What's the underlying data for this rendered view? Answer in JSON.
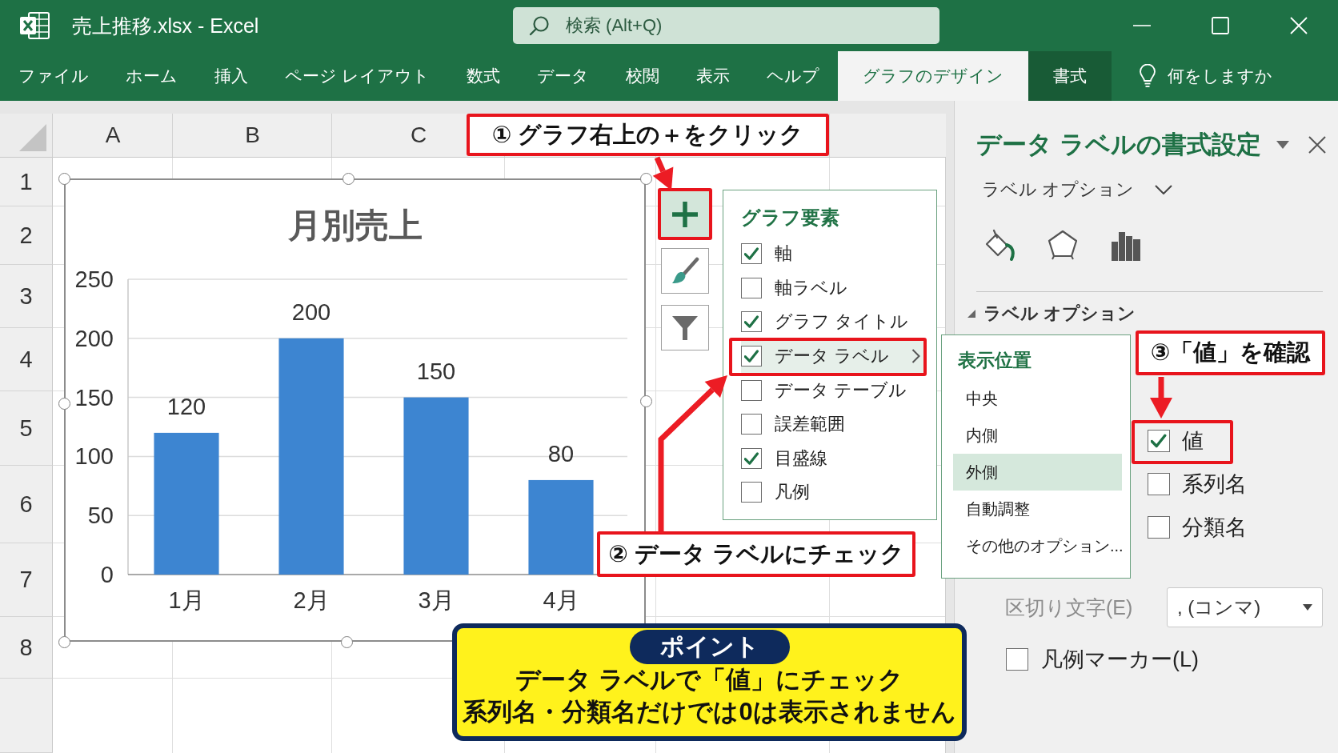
{
  "window": {
    "title": "売上推移.xlsx - Excel",
    "search": {
      "placeholder": "検索 (Alt+Q)"
    }
  },
  "ribbon": {
    "tabs": [
      {
        "label": "ファイル",
        "kind": "standard",
        "selected": false
      },
      {
        "label": "ホーム",
        "kind": "standard",
        "selected": false
      },
      {
        "label": "挿入",
        "kind": "standard",
        "selected": false
      },
      {
        "label": "ページ レイアウト",
        "kind": "standard",
        "selected": false
      },
      {
        "label": "数式",
        "kind": "standard",
        "selected": false
      },
      {
        "label": "データ",
        "kind": "standard",
        "selected": false
      },
      {
        "label": "校閲",
        "kind": "standard",
        "selected": false
      },
      {
        "label": "表示",
        "kind": "standard",
        "selected": false
      },
      {
        "label": "ヘルプ",
        "kind": "standard",
        "selected": false
      },
      {
        "label": "グラフのデザイン",
        "kind": "contextual",
        "selected": true
      },
      {
        "label": "書式",
        "kind": "contextual",
        "selected": false
      }
    ],
    "tell_me": "何をしますか"
  },
  "sheet": {
    "columns": [
      "A",
      "B",
      "C"
    ],
    "rows": [
      "1",
      "2",
      "3",
      "4",
      "5",
      "6",
      "7",
      "8"
    ]
  },
  "chart": {
    "chart_data": {
      "type": "bar",
      "title": "月別売上",
      "categories": [
        "1月",
        "2月",
        "3月",
        "4月"
      ],
      "values": [
        120,
        200,
        150,
        80
      ],
      "ylim": [
        0,
        250
      ],
      "yticks": [
        0,
        50,
        100,
        150,
        200,
        250
      ],
      "grid": true,
      "data_labels": true
    }
  },
  "chart_buttons": [
    {
      "kind": "add",
      "selected": true
    },
    {
      "kind": "style",
      "selected": false
    },
    {
      "kind": "filter",
      "selected": false
    }
  ],
  "chart_elements": {
    "title": "グラフ要素",
    "items": [
      {
        "label": "軸",
        "checked": true,
        "selected": false,
        "submenu": false
      },
      {
        "label": "軸ラベル",
        "checked": false,
        "selected": false,
        "submenu": false
      },
      {
        "label": "グラフ タイトル",
        "checked": true,
        "selected": false,
        "submenu": false
      },
      {
        "label": "データ ラベル",
        "checked": true,
        "selected": true,
        "submenu": true
      },
      {
        "label": "データ テーブル",
        "checked": false,
        "selected": false,
        "submenu": false
      },
      {
        "label": "誤差範囲",
        "checked": false,
        "selected": false,
        "submenu": false
      },
      {
        "label": "目盛線",
        "checked": true,
        "selected": false,
        "submenu": false
      },
      {
        "label": "凡例",
        "checked": false,
        "selected": false,
        "submenu": false
      }
    ]
  },
  "label_position_menu": {
    "title": "表示位置",
    "items": [
      {
        "label": "中央",
        "selected": false
      },
      {
        "label": "内側",
        "selected": false
      },
      {
        "label": "外側",
        "selected": true
      },
      {
        "label": "自動調整",
        "selected": false
      },
      {
        "label": "その他のオプション...",
        "selected": false
      }
    ]
  },
  "format_pane": {
    "title": "データ ラベルの書式設定",
    "options_menu": "ラベル オプション",
    "section": {
      "title": "ラベル オプション",
      "expanded": true
    },
    "label_contains": [
      {
        "label": "値",
        "checked": true
      },
      {
        "label": "系列名",
        "checked": false
      },
      {
        "label": "分類名",
        "checked": false
      }
    ],
    "separator": {
      "label": "区切り文字(E)",
      "value": ", (コンマ)",
      "disabled": true
    },
    "legend_key": {
      "label": "凡例マーカー(L)",
      "checked": false
    }
  },
  "callouts": [
    {
      "text": "① グラフ右上の＋をクリック"
    },
    {
      "text": "② データ ラベルにチェック"
    },
    {
      "text": "③「値」を確認"
    }
  ],
  "point": {
    "badge": "ポイント",
    "lines": [
      "データ ラベルで「値」にチェック",
      "系列名・分類名だけでは0は表示されません"
    ]
  }
}
